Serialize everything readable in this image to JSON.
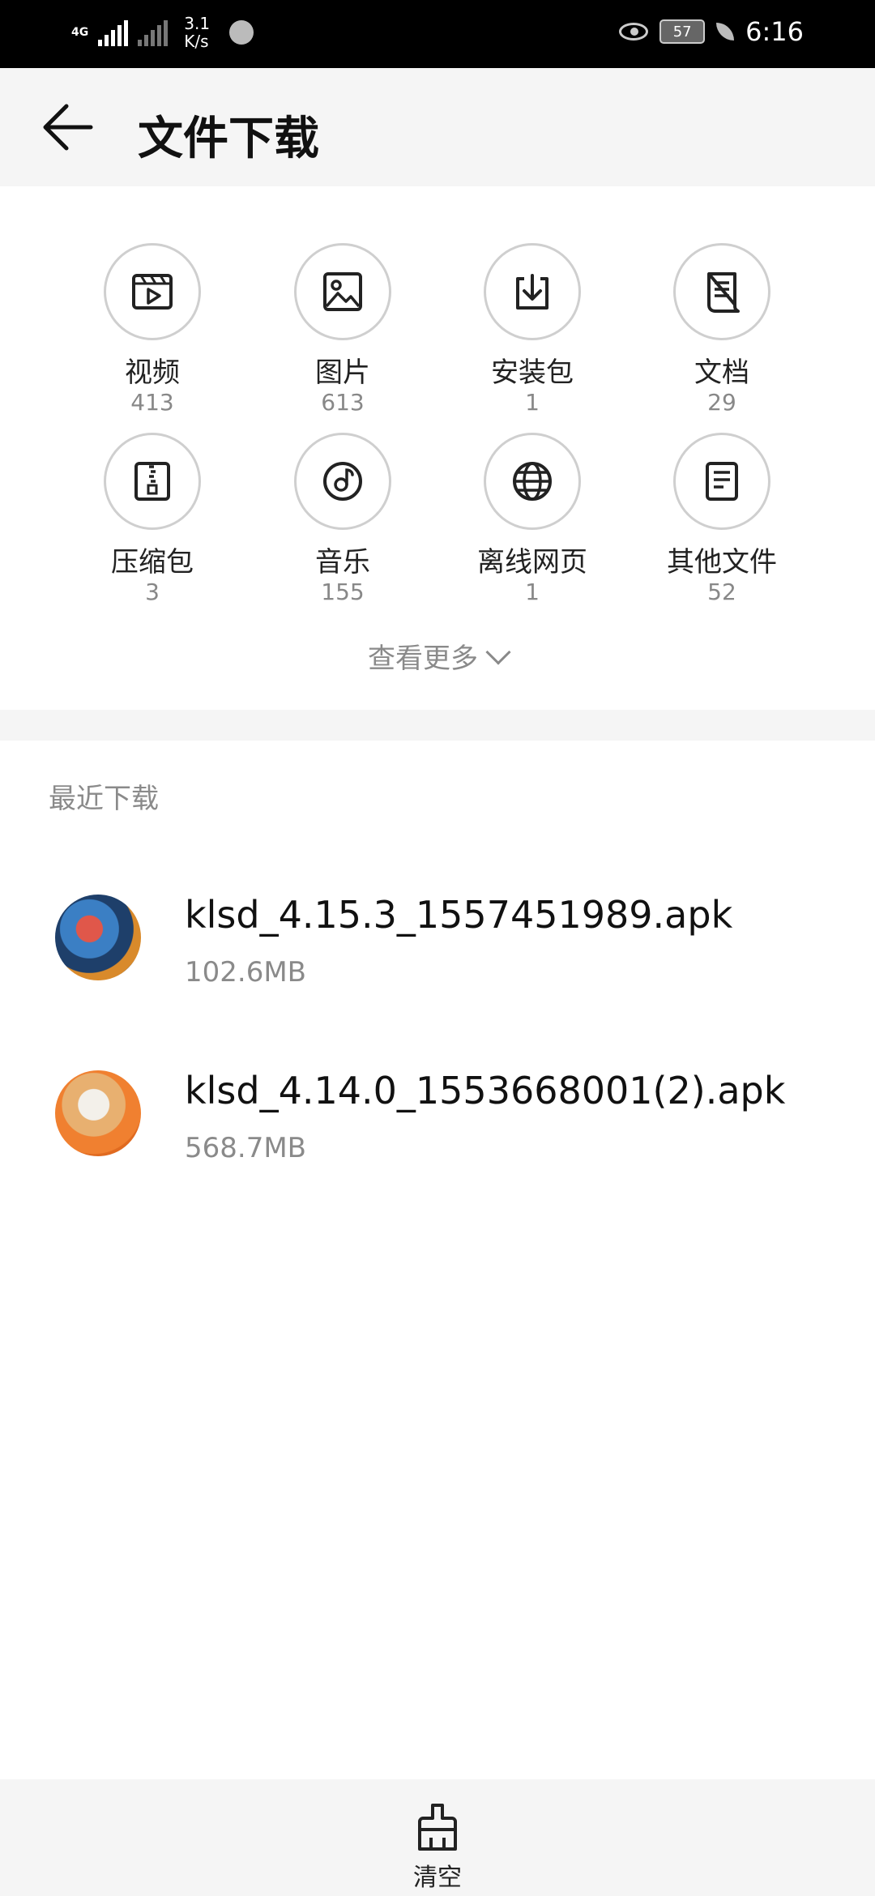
{
  "status_bar": {
    "network": "4G",
    "speed": "3.1",
    "speed_unit": "K/s",
    "battery": "57",
    "time": "6:16"
  },
  "header": {
    "title": "文件下载"
  },
  "categories": [
    {
      "label": "视频",
      "count": "413",
      "icon": "video-icon"
    },
    {
      "label": "图片",
      "count": "613",
      "icon": "image-icon"
    },
    {
      "label": "安装包",
      "count": "1",
      "icon": "install-package-icon"
    },
    {
      "label": "文档",
      "count": "29",
      "icon": "document-icon"
    },
    {
      "label": "压缩包",
      "count": "3",
      "icon": "zip-icon"
    },
    {
      "label": "音乐",
      "count": "155",
      "icon": "music-icon"
    },
    {
      "label": "离线网页",
      "count": "1",
      "icon": "globe-icon"
    },
    {
      "label": "其他文件",
      "count": "52",
      "icon": "file-icon"
    }
  ],
  "more": {
    "label": "查看更多"
  },
  "recent": {
    "title": "最近下载",
    "files": [
      {
        "name": "klsd_4.15.3_1557451989.apk",
        "size": "102.6MB"
      },
      {
        "name": "klsd_4.14.0_1553668001(2).apk",
        "size": "568.7MB"
      }
    ]
  },
  "bottom": {
    "clear_label": "清空"
  }
}
